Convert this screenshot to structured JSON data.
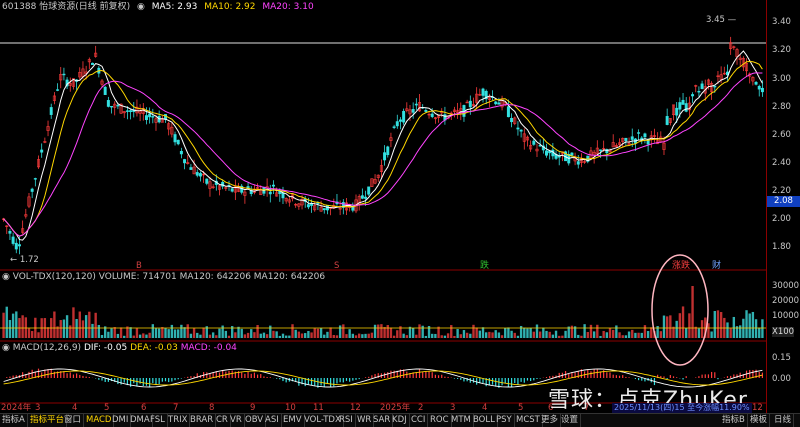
{
  "header": {
    "symbol_name": "601388 怡球资源(日线 前复权)",
    "ma5_label": "MA5: 2.93",
    "ma10_label": "MA10: 2.92",
    "ma20_label": "MA20: 3.10",
    "colors": {
      "ma5": "#ffffff",
      "ma10": "#ffd700",
      "ma20": "#ff44ff"
    }
  },
  "price_axis": {
    "ticks": [
      "3.40",
      "3.20",
      "3.00",
      "2.80",
      "2.60",
      "2.40",
      "2.20",
      "2.00",
      "1.80"
    ],
    "current_price_tag": "2.08",
    "high_marker": "3.45",
    "low_marker": "1.72"
  },
  "markers": {
    "s_mark": "S",
    "b_mark": "B",
    "die": "跌",
    "zhangting": "涨跌",
    "cai": "财"
  },
  "volume_panel": {
    "header": "VOL-TDX(120,120)  VOLUME: 714701  MA120: 642206  MA120: 642206",
    "ticks": [
      "30000",
      "20000",
      "10000"
    ],
    "unit": "X100"
  },
  "macd_panel": {
    "header_name": "MACD(12,26,9)",
    "dif": "DIF: -0.05",
    "dea": "DEA: -0.03",
    "macd": "MACD: -0.04",
    "ticks": [
      "0.15",
      "0.00"
    ]
  },
  "months": [
    "2024年",
    "3",
    "4",
    "5",
    "6",
    "7",
    "8",
    "9",
    "10",
    "11",
    "12",
    "2025年",
    "2",
    "3",
    "4",
    "5",
    "6",
    "7",
    "8",
    "9",
    "10",
    "11",
    "12"
  ],
  "tabs": [
    "指标A",
    "指标平台",
    "窗口",
    "MACD",
    "DMI",
    "DMA",
    "FSL",
    "TRIX",
    "BRAR",
    "CR",
    "VR",
    "OBV",
    "ASI",
    "EMV",
    "VOL-TDX",
    "RSI",
    "WR",
    "SAR",
    "KDJ",
    "CCI",
    "ROC",
    "MTM",
    "BOLL",
    "PSY",
    "MCST",
    "更多",
    "设置"
  ],
  "right_tabs": [
    "指标B",
    "模板",
    "日线"
  ],
  "watermark": "雪球：卢克ZhuKer",
  "watermark_sub": "2025/11/13(四)15 至今涨幅11.90%"
}
